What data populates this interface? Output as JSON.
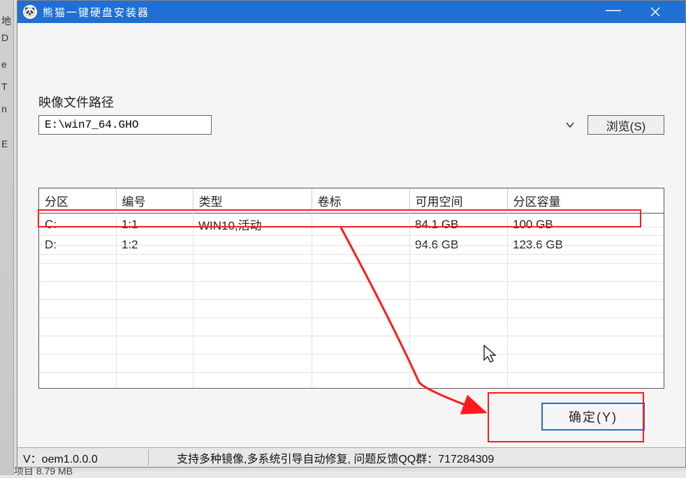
{
  "window": {
    "title": "熊猫一键硬盘安装器"
  },
  "path_section": {
    "label": "映像文件路径",
    "value": "E:\\win7_64.GHO",
    "browse_label": "浏览(S)"
  },
  "table": {
    "headers": {
      "partition": "分区",
      "number": "编号",
      "type": "类型",
      "volume": "卷标",
      "free": "可用空间",
      "capacity": "分区容量"
    },
    "rows": [
      {
        "partition": "C:",
        "number": "1:1",
        "type": "WIN10,活动",
        "volume": "",
        "free": "84.1 GB",
        "capacity": "100 GB"
      },
      {
        "partition": "D:",
        "number": "1:2",
        "type": "",
        "volume": "",
        "free": "94.6 GB",
        "capacity": "123.6 GB"
      }
    ]
  },
  "buttons": {
    "confirm": "确定(Y)"
  },
  "statusbar": {
    "version": "V：oem1.0.0.0",
    "message": "支持多种镜像,多系统引导自动修复, 问题反馈QQ群：717284309"
  },
  "background": {
    "chars": [
      "地",
      "D",
      "e",
      "T",
      "n",
      "E"
    ],
    "under_text": "项目   8.79 MB"
  }
}
